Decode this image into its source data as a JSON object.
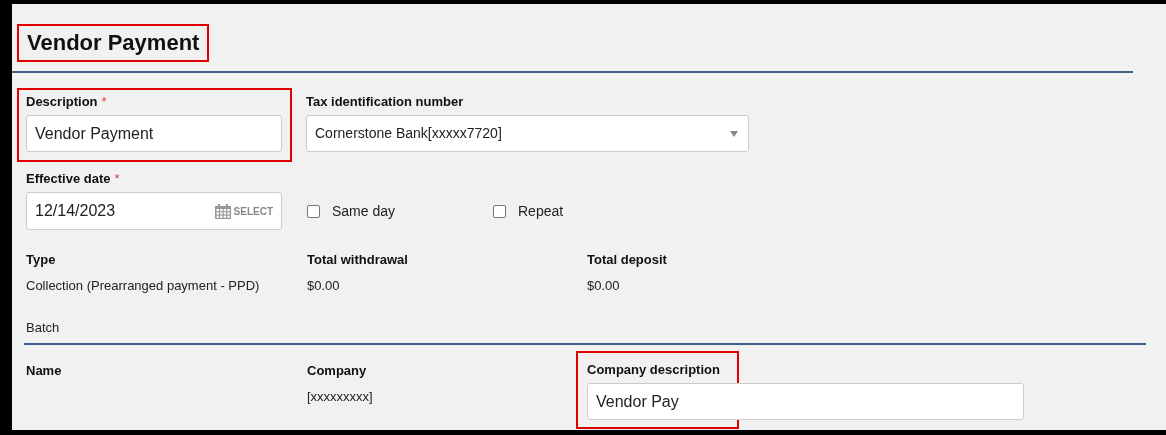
{
  "title": {
    "text": "Vendor Payment",
    "highlighted": true
  },
  "description": {
    "label": "Description",
    "required_mark": "*",
    "value": "Vendor Payment",
    "highlighted": true
  },
  "tax_id": {
    "label": "Tax identification number",
    "value": "Cornerstone Bank[xxxxx7720]"
  },
  "effective_date": {
    "label": "Effective date",
    "required_mark": "*",
    "value": "12/14/2023",
    "button": "SELECT"
  },
  "options": [
    {
      "label": "Same day",
      "checked": false
    },
    {
      "label": "Repeat",
      "checked": false
    }
  ],
  "summary": [
    {
      "label": "Type",
      "value": "Collection (Prearranged payment - PPD)"
    },
    {
      "label": "Total withdrawal",
      "value": "$0.00"
    },
    {
      "label": "Total deposit",
      "value": "$0.00"
    }
  ],
  "batch": {
    "heading": "Batch",
    "name_label": "Name",
    "company_label": "Company",
    "company_value": "[xxxxxxxxx]",
    "company_description": {
      "label": "Company description",
      "value": "Vendor Pay",
      "highlighted": true
    }
  }
}
